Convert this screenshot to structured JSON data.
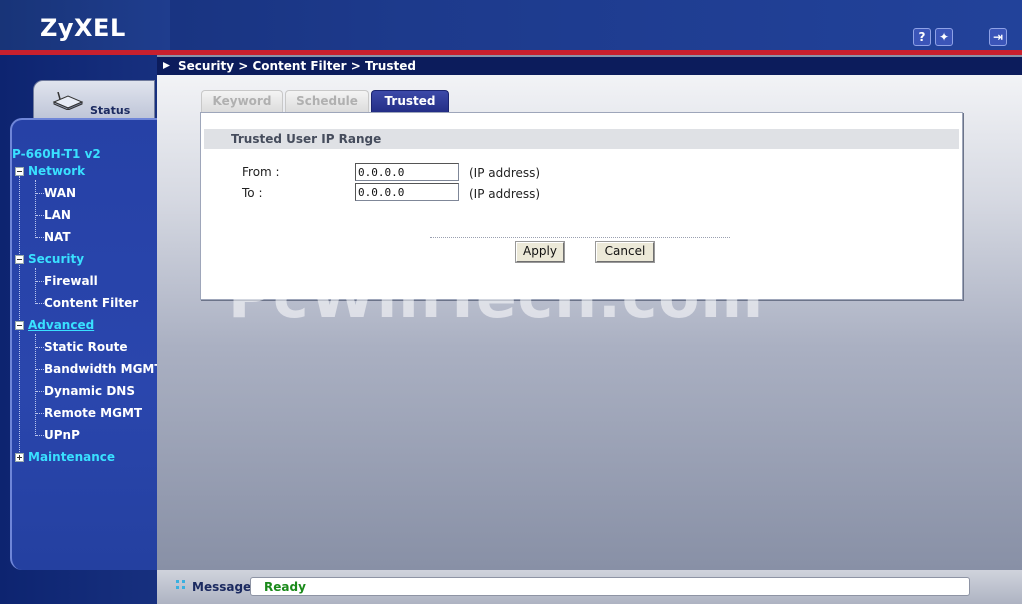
{
  "header": {
    "logo": "ZyXEL",
    "help_icon": "help-icon",
    "wizard_icon": "wizard-icon",
    "logout_icon": "logout-icon"
  },
  "sidebar": {
    "status_label": "Status",
    "device_name": "P-660H-T1 v2",
    "items": [
      {
        "label": "Network",
        "type": "category",
        "state": "expanded"
      },
      {
        "label": "WAN",
        "type": "child"
      },
      {
        "label": "LAN",
        "type": "child"
      },
      {
        "label": "NAT",
        "type": "child"
      },
      {
        "label": "Security",
        "type": "category",
        "state": "expanded"
      },
      {
        "label": "Firewall",
        "type": "child"
      },
      {
        "label": "Content Filter",
        "type": "child"
      },
      {
        "label": "Advanced",
        "type": "category",
        "state": "expanded"
      },
      {
        "label": "Static Route",
        "type": "child"
      },
      {
        "label": "Bandwidth MGMT",
        "type": "child"
      },
      {
        "label": "Dynamic DNS",
        "type": "child"
      },
      {
        "label": "Remote MGMT",
        "type": "child"
      },
      {
        "label": "UPnP",
        "type": "child"
      },
      {
        "label": "Maintenance",
        "type": "category",
        "state": "collapsed"
      }
    ]
  },
  "breadcrumb": "Security > Content Filter > Trusted",
  "tabs": [
    {
      "label": "Keyword",
      "active": false
    },
    {
      "label": "Schedule",
      "active": false
    },
    {
      "label": "Trusted",
      "active": true
    }
  ],
  "form": {
    "section_title": "Trusted User IP Range",
    "from_label": "From :",
    "from_value": "0.0.0.0",
    "to_label": "To :",
    "to_value": "0.0.0.0",
    "ip_note": "(IP address)",
    "apply_label": "Apply",
    "cancel_label": "Cancel"
  },
  "watermark": "PcWinTech.com",
  "footer": {
    "message_label": "Message",
    "message_text": "Ready"
  },
  "colors": {
    "accent": "#39e0ff",
    "header_bg": "#1d3a8c",
    "red_line": "#c8202e",
    "status_ok": "#1a8a1a"
  }
}
